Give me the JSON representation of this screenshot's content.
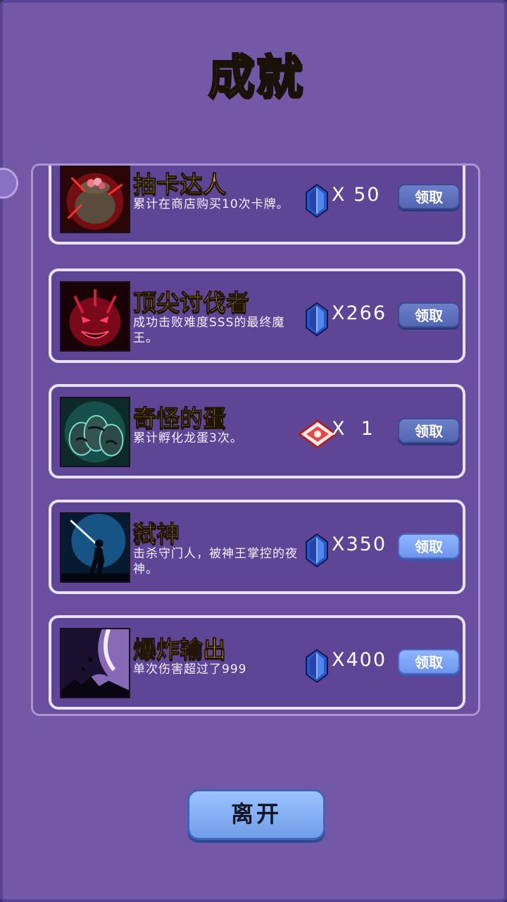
{
  "title": "成就",
  "achievements": [
    {
      "name": "抽卡达人",
      "desc": "累计在商店购买10次卡牌。",
      "reward_icon": "blue-gem-icon",
      "amount": "X 50",
      "claim": "领取",
      "claim_active": false
    },
    {
      "name": "顶尖讨伐者",
      "desc": "成功击败难度SSS的最终魔王。",
      "reward_icon": "blue-gem-icon",
      "amount": "X266",
      "claim": "领取",
      "claim_active": false
    },
    {
      "name": "奇怪的蛋",
      "desc": "累计孵化龙蛋3次。",
      "reward_icon": "red-ticket-icon",
      "amount": "X  1",
      "claim": "领取",
      "claim_active": false
    },
    {
      "name": "弑神",
      "desc": "击杀守门人，被神王掌控的夜神。",
      "reward_icon": "blue-gem-icon",
      "amount": "X350",
      "claim": "领取",
      "claim_active": true
    },
    {
      "name": "爆炸输出",
      "desc": "单次伤害超过了999",
      "reward_icon": "blue-gem-icon",
      "amount": "X400",
      "claim": "领取",
      "claim_active": true
    }
  ],
  "leave_button": "离开",
  "colors": {
    "background": "#7358a8",
    "title": "#f7c21b",
    "name": "#f5d21a",
    "button": "#6f96ec"
  }
}
